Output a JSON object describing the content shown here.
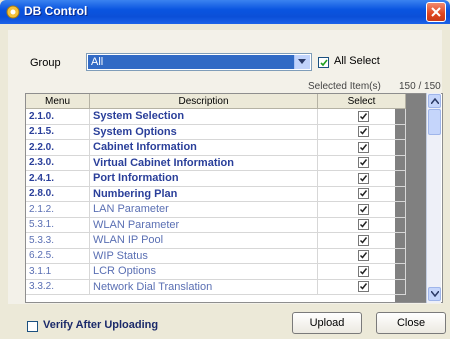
{
  "window": {
    "title": "DB Control"
  },
  "group": {
    "label": "Group",
    "value": "All"
  },
  "all_select": {
    "label": "All Select",
    "checked": true
  },
  "selection": {
    "label": "Selected Item(s)",
    "count": "150 / 150"
  },
  "table": {
    "columns": [
      "Menu",
      "Description",
      "Select"
    ],
    "rows": [
      {
        "menu": "2.1.0.",
        "desc": "System Selection",
        "bold": true,
        "checked": true
      },
      {
        "menu": "2.1.5.",
        "desc": "System Options",
        "bold": true,
        "checked": true
      },
      {
        "menu": "2.2.0.",
        "desc": "Cabinet Information",
        "bold": true,
        "checked": true
      },
      {
        "menu": "2.3.0.",
        "desc": "Virtual Cabinet Information",
        "bold": true,
        "checked": true
      },
      {
        "menu": "2.4.1.",
        "desc": "Port Information",
        "bold": true,
        "checked": true
      },
      {
        "menu": "2.8.0.",
        "desc": "Numbering Plan",
        "bold": true,
        "checked": true
      },
      {
        "menu": "2.1.2.",
        "desc": "LAN Parameter",
        "bold": false,
        "checked": true
      },
      {
        "menu": "5.3.1.",
        "desc": "WLAN Parameter",
        "bold": false,
        "checked": true
      },
      {
        "menu": "5.3.3.",
        "desc": "WLAN IP Pool",
        "bold": false,
        "checked": true
      },
      {
        "menu": "6.2.5.",
        "desc": "WIP Status",
        "bold": false,
        "checked": true
      },
      {
        "menu": "3.1.1",
        "desc": "LCR Options",
        "bold": false,
        "checked": true
      },
      {
        "menu": "3.3.2.",
        "desc": "Network Dial Translation",
        "bold": false,
        "checked": true
      }
    ]
  },
  "verify": {
    "label": "Verify After Uploading",
    "checked": false
  },
  "buttons": {
    "upload": "Upload",
    "close": "Close"
  },
  "colors": {
    "title_bar": "#0b4fd8",
    "selection": "#316ac5",
    "link_text": "#2a3f9a"
  }
}
